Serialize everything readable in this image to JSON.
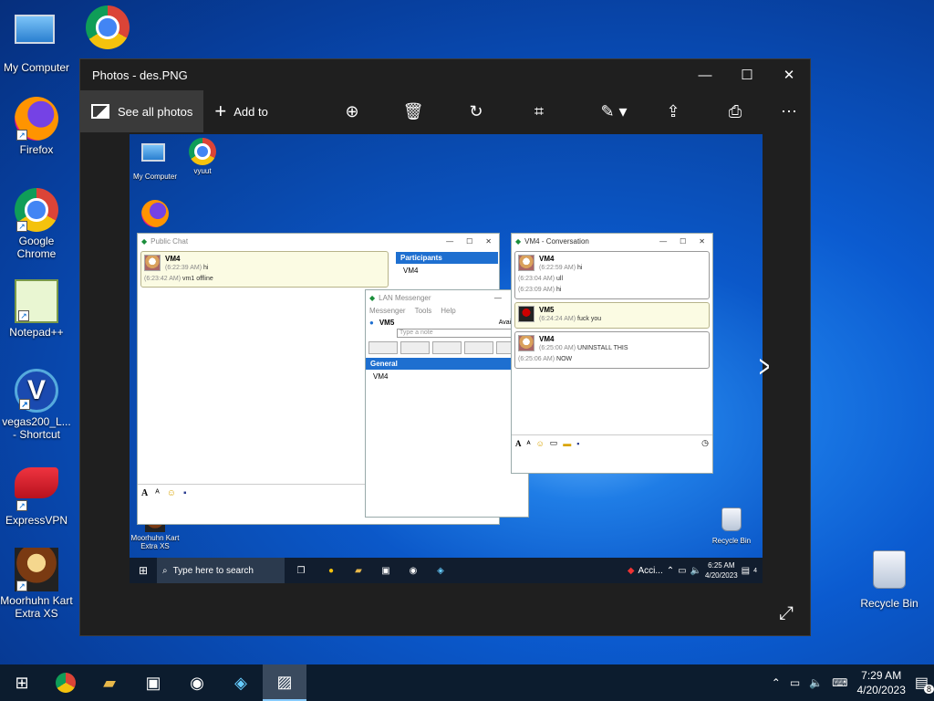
{
  "desktop": {
    "icons": [
      {
        "label": "My Computer"
      },
      {
        "label": "Firefox"
      },
      {
        "label": "Google Chrome"
      },
      {
        "label": "Notepad++"
      },
      {
        "label": "vegas200_L... - Shortcut"
      },
      {
        "label": "ExpressVPN"
      },
      {
        "label": "Moorhuhn Kart Extra XS"
      },
      {
        "label": "Recycle Bin"
      }
    ]
  },
  "photos": {
    "title": "Photos - des.PNG",
    "see_all": "See all photos",
    "add_to": "Add to"
  },
  "inner": {
    "icons": [
      {
        "label": "My Computer"
      },
      {
        "label": "vyuut"
      },
      {
        "label": "Moorhuhn Kart Extra XS"
      },
      {
        "label": "Recycle Bin"
      }
    ],
    "public_chat": {
      "title": "Public Chat",
      "msg_name": "VM4",
      "line1_time": "(6:22:39 AM)",
      "line1_text": "hi",
      "line2_time": "(6:23:42 AM)",
      "line2_text": "vm1  offline",
      "participants_header": "Participants",
      "participant": "VM4"
    },
    "lan": {
      "title": "LAN Messenger",
      "menu": [
        "Messenger",
        "Tools",
        "Help"
      ],
      "user": "VM5",
      "status": "Available",
      "note_placeholder": "Type a note",
      "group": "General",
      "member": "VM4"
    },
    "conv": {
      "title": "VM4 - Conversation",
      "m1_name": "VM4",
      "m1_l1_time": "(6:22:59 AM)",
      "m1_l1_text": "hi",
      "m1_l2_time": "(6:23:04 AM)",
      "m1_l2_text": "ull",
      "m1_l3_time": "(6:23:09 AM)",
      "m1_l3_text": "hi",
      "m2_name": "VM5",
      "m2_time": "(6:24:24 AM)",
      "m2_text": "fuck you",
      "m3_name": "VM4",
      "m3_l1_time": "(6:25:00 AM)",
      "m3_l1_text": "UNINSTALL THIS",
      "m3_l2_time": "(6:25:06 AM)",
      "m3_l2_text": "NOW"
    },
    "taskbar": {
      "search": "Type here to search",
      "tray_app": "Acci...",
      "time": "6:25 AM",
      "date": "4/20/2023",
      "badge": "4"
    }
  },
  "taskbar": {
    "time": "7:29 AM",
    "date": "4/20/2023",
    "notifications": "8"
  }
}
